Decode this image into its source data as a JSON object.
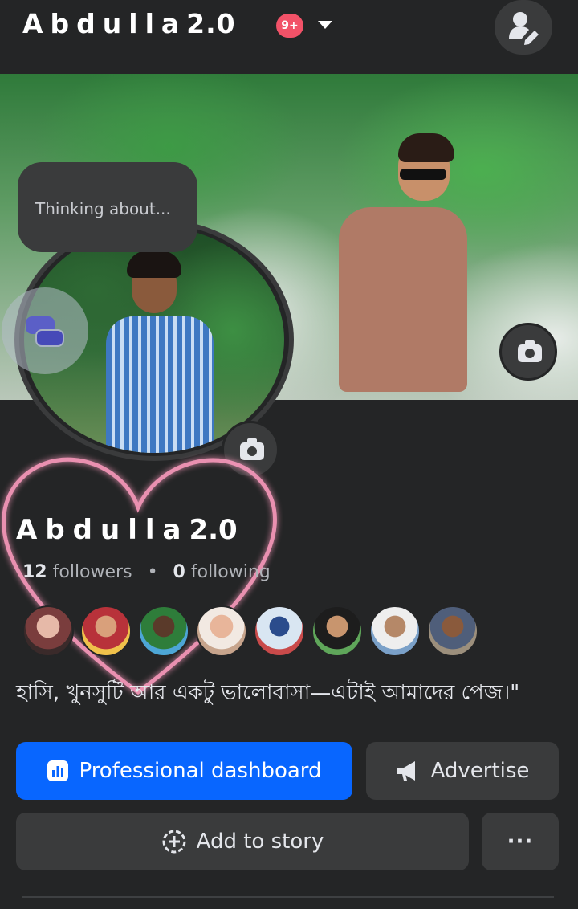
{
  "header": {
    "page_name": "Abdulla",
    "page_name_suffix": "2.0",
    "notification_badge": "9+"
  },
  "profile": {
    "thought_placeholder": "Thinking about...",
    "display_name": "Abdulla",
    "display_name_suffix": "2.0",
    "followers_count": "12",
    "followers_label": "followers",
    "following_count": "0",
    "following_label": "following",
    "bio": "হাসি, খুনসুটি আর একটু ভালোবাসা—এটাই আমাদের পেজ।\""
  },
  "actions": {
    "professional_dashboard": "Professional dashboard",
    "advertise": "Advertise",
    "add_to_story": "Add to story",
    "more": "···"
  },
  "colors": {
    "background": "#242526",
    "surface": "#3a3b3c",
    "primary": "#0866ff",
    "badge": "#f25268",
    "text": "#e4e6eb",
    "muted_text": "#b0b3b8"
  },
  "icons": {
    "profile_switch": "person-edit-icon",
    "camera": "camera-icon",
    "messenger": "messenger-icon",
    "dashboard": "bar-chart-icon",
    "advertise": "megaphone-icon",
    "add_story": "add-circle-icon"
  }
}
